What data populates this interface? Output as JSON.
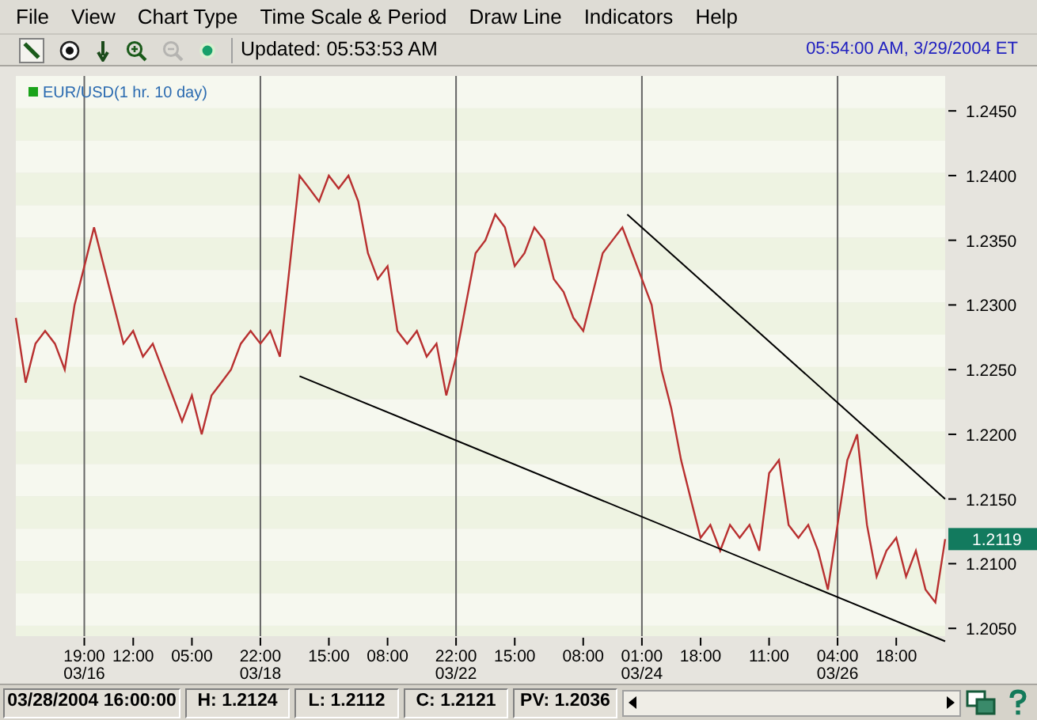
{
  "menu": [
    "File",
    "View",
    "Chart Type",
    "Time Scale & Period",
    "Draw Line",
    "Indicators",
    "Help"
  ],
  "toolbar": {
    "tools": [
      {
        "kind": "pen",
        "disabled": false
      },
      {
        "kind": "target",
        "disabled": false
      },
      {
        "kind": "down",
        "disabled": false
      },
      {
        "kind": "zoomin",
        "disabled": false
      },
      {
        "kind": "zoomout",
        "disabled": true
      },
      {
        "kind": "status",
        "disabled": false
      }
    ],
    "updated": "Updated: 05:53:53 AM",
    "clock": "05:54:00 AM, 3/29/2004 ET"
  },
  "chart": {
    "legend": {
      "color": "#1aa31a"
    },
    "last_price": "1.2119",
    "chart_data": {
      "type": "line",
      "ylim": [
        1.2044,
        1.2477
      ],
      "grid": true,
      "categories": [
        null,
        null,
        null,
        null,
        null,
        null,
        null,
        "19:00\n03/16",
        null,
        null,
        null,
        null,
        "12:00",
        null,
        null,
        null,
        null,
        null,
        "05:00",
        null,
        null,
        null,
        null,
        null,
        null,
        "22:00\n03/18",
        null,
        null,
        null,
        null,
        null,
        null,
        "15:00",
        null,
        null,
        null,
        null,
        null,
        "08:00",
        null,
        null,
        null,
        null,
        null,
        null,
        "22:00\n03/22",
        null,
        null,
        null,
        null,
        null,
        "15:00",
        null,
        null,
        null,
        null,
        null,
        null,
        "08:00",
        null,
        null,
        null,
        null,
        null,
        "01:00\n03/24",
        null,
        null,
        null,
        null,
        null,
        "18:00",
        null,
        null,
        null,
        null,
        null,
        null,
        "11:00",
        null,
        null,
        null,
        null,
        null,
        null,
        "04:00\n03/26",
        null,
        null,
        null,
        null,
        null,
        "18:00",
        null,
        null,
        null,
        null,
        null
      ],
      "series": [
        {
          "name": "EUR/USD(1 hr. 10 day)",
          "color": "#b83030",
          "values": [
            1.229,
            1.224,
            1.227,
            1.228,
            1.227,
            1.225,
            1.23,
            1.233,
            1.236,
            1.233,
            1.23,
            1.227,
            1.228,
            1.226,
            1.227,
            1.225,
            1.223,
            1.221,
            1.223,
            1.22,
            1.223,
            1.224,
            1.225,
            1.227,
            1.228,
            1.227,
            1.228,
            1.226,
            1.233,
            1.24,
            1.239,
            1.238,
            1.24,
            1.239,
            1.24,
            1.238,
            1.234,
            1.232,
            1.233,
            1.228,
            1.227,
            1.228,
            1.226,
            1.227,
            1.223,
            1.226,
            1.23,
            1.234,
            1.235,
            1.237,
            1.236,
            1.233,
            1.234,
            1.236,
            1.235,
            1.232,
            1.231,
            1.229,
            1.228,
            1.231,
            1.234,
            1.235,
            1.236,
            1.234,
            1.232,
            1.23,
            1.225,
            1.222,
            1.218,
            1.215,
            1.212,
            1.213,
            1.211,
            1.213,
            1.212,
            1.213,
            1.211,
            1.217,
            1.218,
            1.213,
            1.212,
            1.213,
            1.211,
            1.208,
            1.213,
            1.218,
            1.22,
            1.213,
            1.209,
            1.211,
            1.212,
            1.209,
            1.211,
            1.208,
            1.207,
            1.2119
          ]
        }
      ],
      "yticks": [
        {
          "value": 1.205,
          "label": "1.2050"
        },
        {
          "value": 1.21,
          "label": "1.2100"
        },
        {
          "value": 1.215,
          "label": "1.2150"
        },
        {
          "value": 1.22,
          "label": "1.2200"
        },
        {
          "value": 1.225,
          "label": "1.2250"
        },
        {
          "value": 1.23,
          "label": "1.2300"
        },
        {
          "value": 1.235,
          "label": "1.2350"
        },
        {
          "value": 1.24,
          "label": "1.2400"
        },
        {
          "value": 1.245,
          "label": "1.2450"
        }
      ]
    }
  },
  "status_bar": {
    "cells": [
      "03/28/2004 16:00:00",
      "H: 1.2124",
      "L: 1.2112",
      "C: 1.2121",
      "PV: 1.2036"
    ]
  }
}
